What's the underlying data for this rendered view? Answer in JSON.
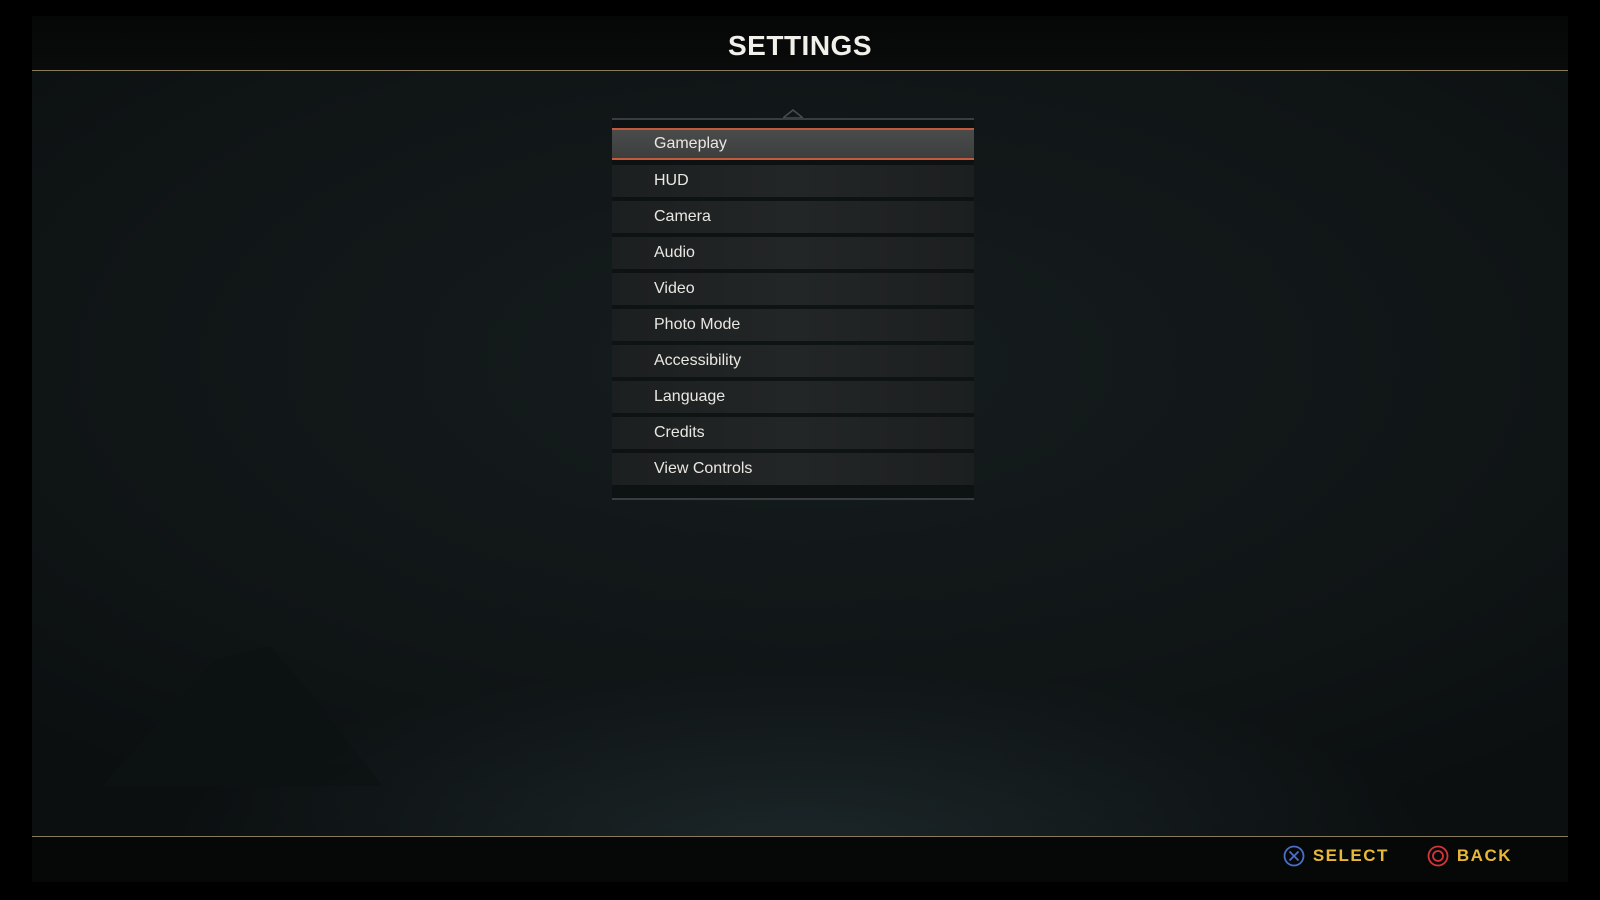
{
  "header": {
    "title": "SETTINGS"
  },
  "menu": {
    "selected_index": 0,
    "items": [
      {
        "label": "Gameplay"
      },
      {
        "label": "HUD"
      },
      {
        "label": "Camera"
      },
      {
        "label": "Audio"
      },
      {
        "label": "Video"
      },
      {
        "label": "Photo Mode"
      },
      {
        "label": "Accessibility"
      },
      {
        "label": "Language"
      },
      {
        "label": "Credits"
      },
      {
        "label": "View Controls"
      }
    ]
  },
  "footer": {
    "prompts": [
      {
        "icon": "cross-button-icon",
        "label": "SELECT",
        "icon_color": "#4a6fc9"
      },
      {
        "icon": "circle-button-icon",
        "label": "BACK",
        "icon_color": "#d6343a"
      }
    ],
    "label_color": "#e8b73a"
  },
  "colors": {
    "accent_rule": "#8a7a5e",
    "selection_border": "#c45a3c"
  }
}
